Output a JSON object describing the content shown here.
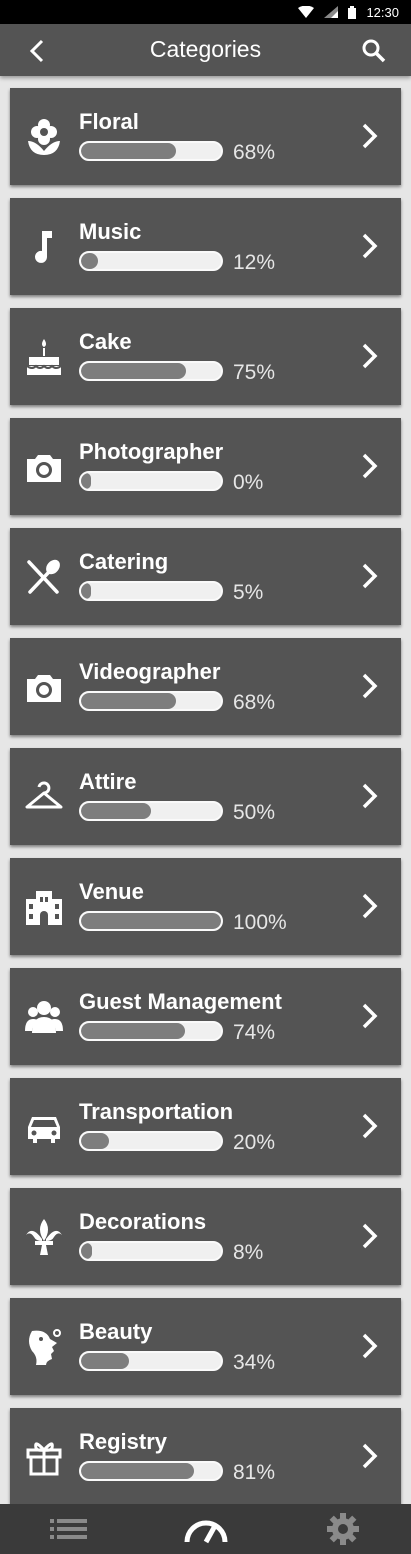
{
  "status_bar": {
    "time": "12:30",
    "icons": [
      "wifi-icon",
      "signal-icon",
      "battery-icon"
    ]
  },
  "app_bar": {
    "title": "Categories",
    "back_icon": "back-arrow-icon",
    "search_icon": "search-icon"
  },
  "categories": [
    {
      "label": "Floral",
      "percent_text": "68%",
      "progress": 0.68,
      "icon": "flower-icon"
    },
    {
      "label": "Music",
      "percent_text": "12%",
      "progress": 0.12,
      "icon": "music-note-icon"
    },
    {
      "label": "Cake",
      "percent_text": "75%",
      "progress": 0.75,
      "icon": "cake-icon"
    },
    {
      "label": "Photographer",
      "percent_text": "0%",
      "progress": 0.0,
      "icon": "camera-icon"
    },
    {
      "label": "Catering",
      "percent_text": "5%",
      "progress": 0.05,
      "icon": "utensils-icon"
    },
    {
      "label": "Videographer",
      "percent_text": "68%",
      "progress": 0.68,
      "icon": "camera-icon"
    },
    {
      "label": "Attire",
      "percent_text": "50%",
      "progress": 0.5,
      "icon": "hanger-icon"
    },
    {
      "label": "Venue",
      "percent_text": "100%",
      "progress": 1.0,
      "icon": "building-icon"
    },
    {
      "label": "Guest Management",
      "percent_text": "74%",
      "progress": 0.74,
      "icon": "people-icon"
    },
    {
      "label": "Transportation",
      "percent_text": "20%",
      "progress": 0.2,
      "icon": "car-icon"
    },
    {
      "label": "Decorations",
      "percent_text": "8%",
      "progress": 0.08,
      "icon": "fleur-de-lis-icon"
    },
    {
      "label": "Beauty",
      "percent_text": "34%",
      "progress": 0.34,
      "icon": "beauty-face-icon"
    },
    {
      "label": "Registry",
      "percent_text": "81%",
      "progress": 0.81,
      "icon": "gift-icon"
    }
  ],
  "bottom_nav": [
    {
      "icon": "list-icon"
    },
    {
      "icon": "gauge-icon",
      "active": true
    },
    {
      "icon": "gear-icon"
    }
  ],
  "colors": {
    "app_bar": "#545454",
    "card": "#545454",
    "background": "#e6e6e6",
    "bar_fill": "#7d7d7d",
    "bottom_nav": "#3a3a3a"
  }
}
